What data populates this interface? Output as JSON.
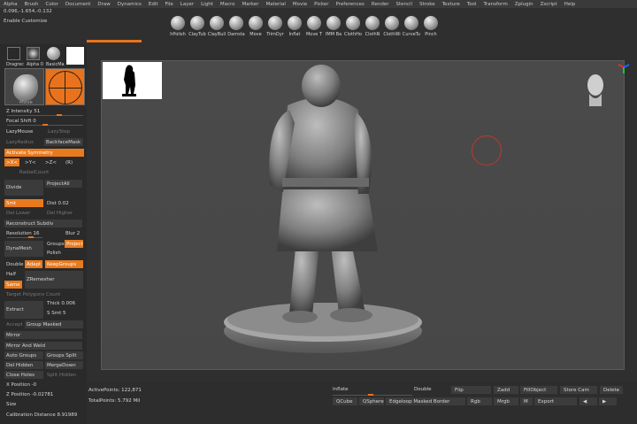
{
  "menu": [
    "Alpha",
    "Brush",
    "Color",
    "Document",
    "Draw",
    "Dynamics",
    "Edit",
    "File",
    "Layer",
    "Light",
    "Macro",
    "Marker",
    "Material",
    "Movie",
    "Picker",
    "Preferences",
    "Render",
    "Stencil",
    "Stroke",
    "Texture",
    "Tool",
    "Transform",
    "Zplugin",
    "Zscript",
    "Help"
  ],
  "coords": "0.096,-1.654,-0.132",
  "enable_customize": "Enable Customize",
  "brushes": [
    "hPolish",
    "ClayTub",
    "ClayBuil",
    "Damsta",
    "Move",
    "TrimDyr",
    "Inflat",
    "Move T",
    "IMM Ba",
    "ClothHo",
    "ClothN",
    "ClothWi",
    "CurveTu",
    "Pinch"
  ],
  "left": {
    "thumbs": [
      "Dragrec",
      "Alpha 0",
      "BasicMa"
    ],
    "move_label": "Move",
    "z_intensity": "Z Intensity 51",
    "focal_shift": "Focal Shift 0",
    "lazymouse": "LazyMouse",
    "lazystep": "LazyStep",
    "backface_mask": "BackfaceMask",
    "lazy_radius": "LazyRadius",
    "activate_symmetry": "Activate Symmetry",
    "sym_x": ">X<",
    "sym_y": ">Y<",
    "sym_z": ">Z<",
    "sym_r": "(R)",
    "radial_count": "RadialCount",
    "divide": "Divide",
    "project_all": "ProjectAll",
    "smt": "Smt",
    "suv": "Suv",
    "dist": "Dist 0.02",
    "del_lower": "Del Lower",
    "del_higher": "Del Higher",
    "reconstruct": "Reconstruct Subdiv",
    "resolution": "Resolution 16",
    "blur": "Blur 2",
    "dynamesh": "DynaMesh",
    "groups": "Groups",
    "project": "Project",
    "polish": "Polish",
    "double": "Double",
    "adapt": "Adapt",
    "keep_groups": "KeepGroups",
    "half": "Half",
    "same": "Same",
    "zremesher": "ZRemesher",
    "target_polygons": "Target Polygons Count",
    "extract": "Extract",
    "thick": "Thick 0.006",
    "s_smt": "S Smt 5",
    "accept": "Accept",
    "group_masked": "Group Masked",
    "mirror": "Mirror",
    "mirror_weld": "Mirror And Weld",
    "auto_groups": "Auto Groups",
    "groups_split": "Groups Split",
    "del_hidden": "Del Hidden",
    "merge_down": "MergeDown",
    "close_holes": "Close Holes",
    "split_hidden": "Split Hidden",
    "x_position": "X Position -0",
    "z_position": "Z Position -0.02781",
    "size": "Size",
    "calibration": "Calibration Distance 8.91989"
  },
  "status": {
    "active_points": "ActivePoints: 122,871",
    "total_points": "TotalPoints: 5.792 Mil"
  },
  "bottom": {
    "inflate": "Inflate",
    "double": "Double",
    "flip": "Flip",
    "zadd": "Zadd",
    "fill_object": "FillObject",
    "store_cam": "Store Cam",
    "delete": "Delete",
    "qcube": "QCube",
    "qsphere": "QSphere",
    "edgeloop": "Edgeloop Masked Border",
    "rgb": "Rgb",
    "mrgb": "Mrgb",
    "m": "M",
    "export": "Export",
    "arrow_left": "◀",
    "arrow_right": "▶"
  },
  "colors": {
    "accent": "#e87a1e",
    "panel": "#2a2a2a",
    "canvas": "#4a4a4a"
  }
}
